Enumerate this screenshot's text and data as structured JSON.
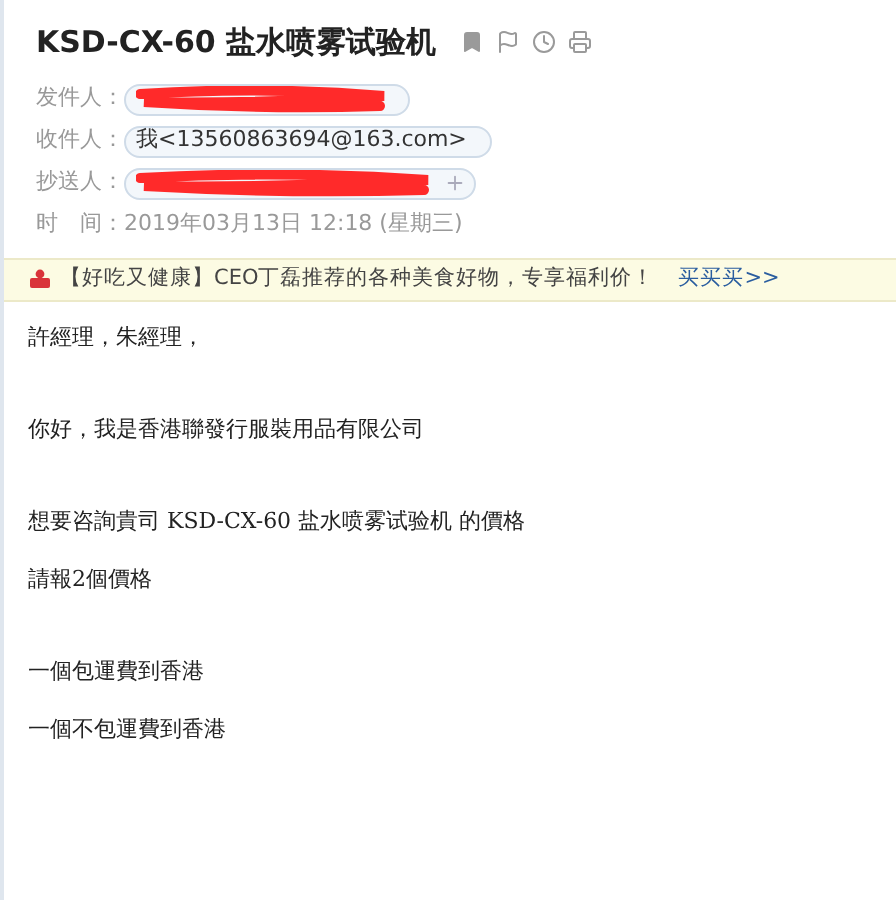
{
  "mail": {
    "subject": "KSD-CX-60 盐水喷雾试验机",
    "fields": [
      {
        "label": "发件人：",
        "kind": "chip",
        "redacted": true,
        "add_button": false
      },
      {
        "label": "收件人：",
        "kind": "chip",
        "value": "我<13560863694@163.com>",
        "redacted": false,
        "add_button": false
      },
      {
        "label": "抄送人：",
        "kind": "chip",
        "redacted": true,
        "add_button": true
      },
      {
        "label": "时　间：",
        "kind": "text",
        "value": "2019年03月13日 12:18 (星期三)"
      }
    ]
  },
  "banner": {
    "text": "【好吃又健康】CEO丁磊推荐的各种美食好物，专享福利价！",
    "link": "买买买>>"
  },
  "body": {
    "blocks": [
      [
        "許經理，朱經理，"
      ],
      [
        "你好，我是香港聯發行服裝用品有限公司"
      ],
      [
        "想要咨詢貴司 KSD-CX-60 盐水喷雾试验机 的價格",
        "請報2個價格"
      ],
      [
        "一個包運費到香港",
        "一個不包運費到香港"
      ]
    ]
  }
}
